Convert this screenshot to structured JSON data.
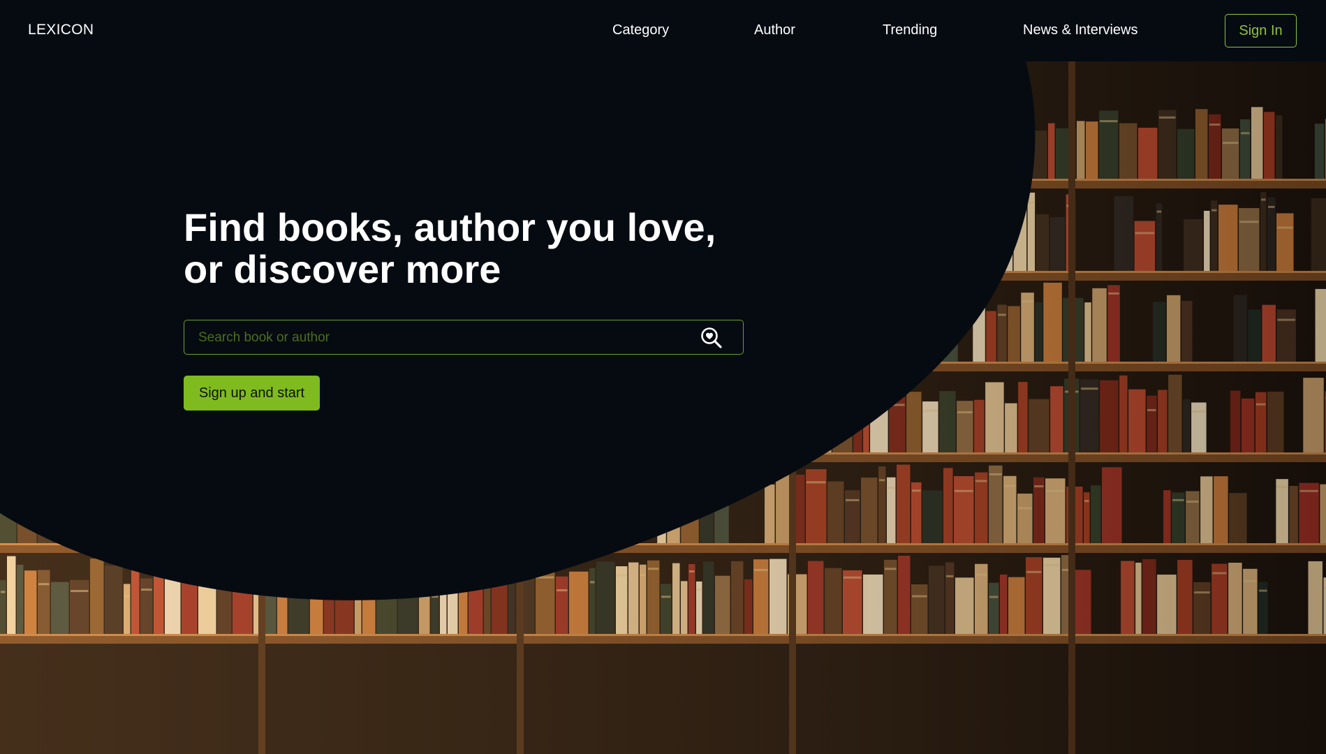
{
  "brand": {
    "name": "LEXICON"
  },
  "nav": {
    "items": [
      {
        "label": "Category"
      },
      {
        "label": "Author"
      },
      {
        "label": "Trending"
      },
      {
        "label": "News & Interviews"
      }
    ],
    "signin_label": "Sign In"
  },
  "hero": {
    "title_line1": "Find books, author you love,",
    "title_line2": "or discover more",
    "search_placeholder": "Search book or author",
    "cta_label": "Sign up and start"
  },
  "colors": {
    "background": "#060b12",
    "accent": "#7fbb1f",
    "accent_border": "#8fc33a",
    "text": "#ffffff"
  },
  "icons": {
    "search": "search-icon"
  }
}
